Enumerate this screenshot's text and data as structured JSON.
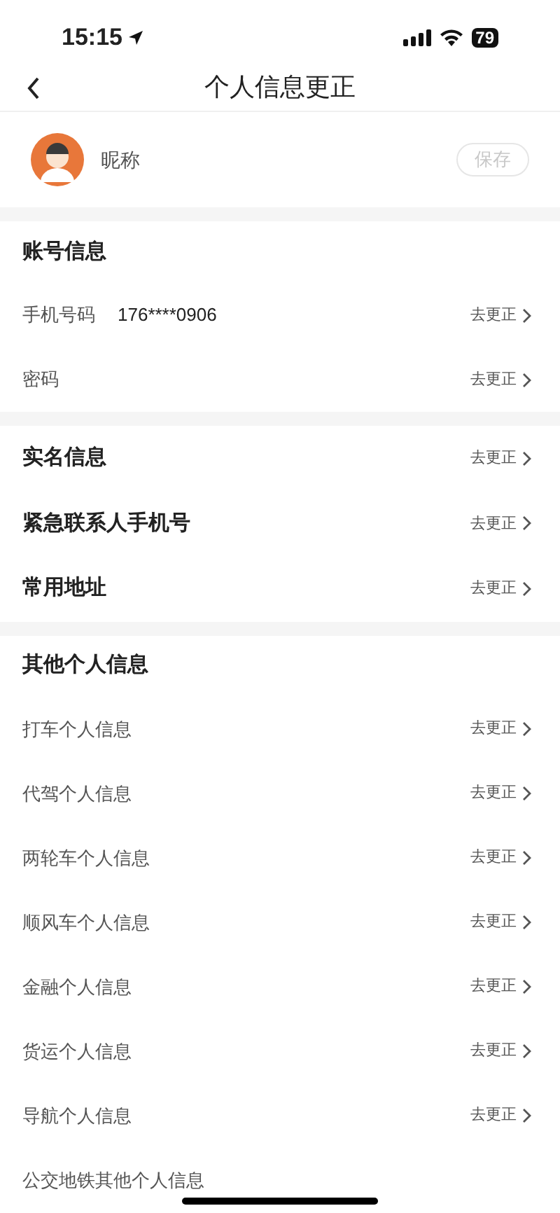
{
  "status_bar": {
    "time": "15:15",
    "battery": "79"
  },
  "nav": {
    "title": "个人信息更正"
  },
  "profile": {
    "nickname": "昵称",
    "save_button": "保存",
    "save_disabled": true
  },
  "sections": [
    {
      "title": "账号信息",
      "items": [
        {
          "label": "手机号码",
          "value": "176****0906",
          "action": "去更正",
          "bold": false
        },
        {
          "label": "密码",
          "action": "去更正",
          "bold": false
        }
      ]
    },
    {
      "items": [
        {
          "label": "实名信息",
          "action": "去更正",
          "bold": true
        },
        {
          "label": "紧急联系人手机号",
          "action": "去更正",
          "bold": true
        },
        {
          "label": "常用地址",
          "action": "去更正",
          "bold": true
        }
      ]
    },
    {
      "title": "其他个人信息",
      "items": [
        {
          "label": "打车个人信息",
          "action": "去更正",
          "bold": false
        },
        {
          "label": "代驾个人信息",
          "action": "去更正",
          "bold": false
        },
        {
          "label": "两轮车个人信息",
          "action": "去更正",
          "bold": false
        },
        {
          "label": "顺风车个人信息",
          "action": "去更正",
          "bold": false
        },
        {
          "label": "金融个人信息",
          "action": "去更正",
          "bold": false
        },
        {
          "label": "货运个人信息",
          "action": "去更正",
          "bold": false
        },
        {
          "label": "导航个人信息",
          "action": "去更正",
          "bold": false
        },
        {
          "label": "公交地铁其他个人信息",
          "bold": false
        }
      ]
    }
  ]
}
